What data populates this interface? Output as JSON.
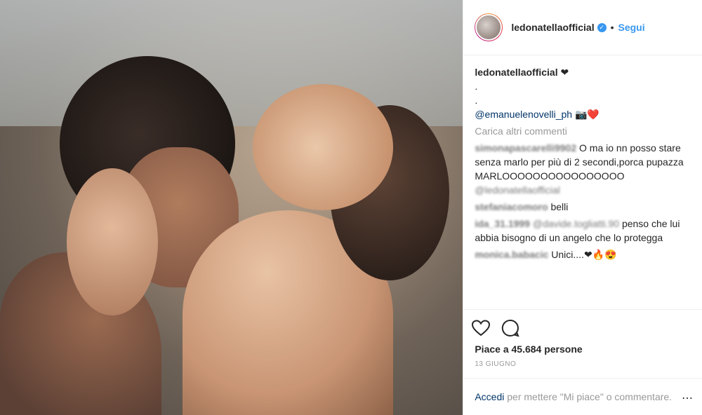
{
  "post": {
    "username": "ledonatellaofficial",
    "verified_icon": "verified-badge-icon",
    "dot": "•",
    "follow_label": "Segui"
  },
  "caption": {
    "username": "ledonatellaofficial",
    "emoji": "❤",
    "line2": ".",
    "line3": ".",
    "mention": "@emanuelenovelli_ph",
    "emoji2": "📷❤️"
  },
  "load_more": "Carica altri commenti",
  "comments": [
    {
      "user": "simonapascarelli9902",
      "text": "O ma io nn posso stare senza marlo per più di 2 secondi,porca pupazza MARLOOOOOOOOOOOOOOOO",
      "mention": "@ledonatellaofficial"
    },
    {
      "user": "stefaniacomoro",
      "text": "belli"
    },
    {
      "user": "ida_31.1999",
      "mention": "@davide.togliatti.90",
      "text": "penso che lui abbia bisogno di un angelo che lo protegga"
    },
    {
      "user": "monica.babacic",
      "text": "Unici....❤🔥😍"
    }
  ],
  "likes": {
    "label": "Piace a 45.684 persone"
  },
  "date": "13 GIUGNO",
  "login": {
    "link": "Accedi",
    "text": " per mettere \"Mi piace\" o commentare."
  },
  "more_icon": "⋯",
  "colors": {
    "accent": "#3897f0",
    "link": "#003569",
    "muted": "#999999"
  }
}
